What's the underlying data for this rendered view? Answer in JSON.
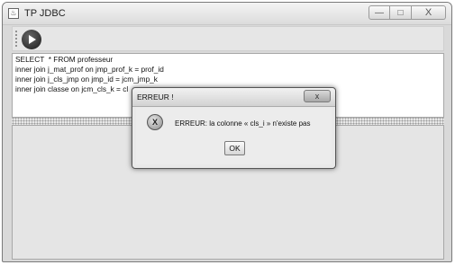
{
  "window": {
    "title": "TP JDBC",
    "app_icon": "java-cup-icon",
    "controls": {
      "minimize": "—",
      "maximize": "□",
      "close": "X"
    }
  },
  "toolbar": {
    "run_icon": "play-circle-icon"
  },
  "editor": {
    "sql": "SELECT  * FROM professeur\ninner join j_mat_prof on jmp_prof_k = prof_id\ninner join j_cls_jmp on jmp_id = jcm_jmp_k\ninner join classe on jcm_cls_k = cl"
  },
  "dialog": {
    "title": "ERREUR !",
    "close_label": "x",
    "icon": "error-x-icon",
    "message": "ERREUR: la colonne « cls_i » n'existe pas",
    "ok_label": "OK"
  }
}
